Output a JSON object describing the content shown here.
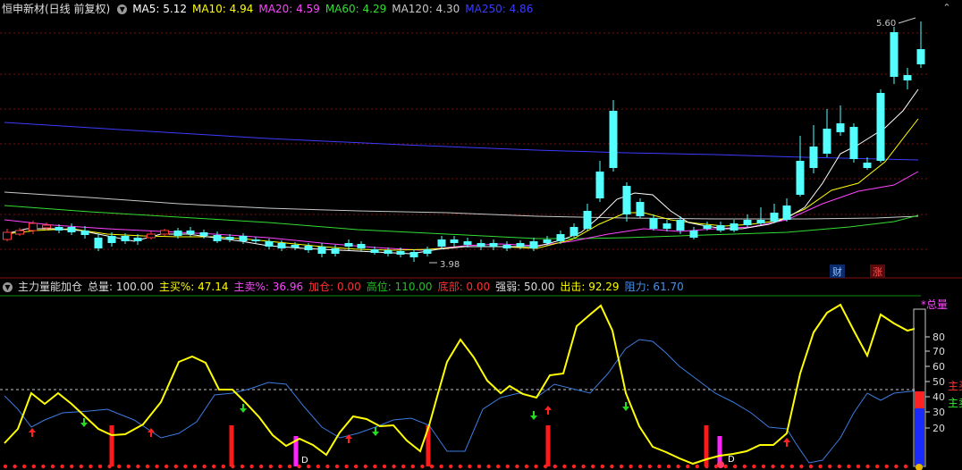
{
  "top_panel": {
    "title": "恒申新材(日线 前复权)",
    "ma": [
      {
        "label": "MA5: 5.12",
        "color": "#ffffff"
      },
      {
        "label": "MA10: 4.94",
        "color": "#ffff00"
      },
      {
        "label": "MA20: 4.59",
        "color": "#ff44ff"
      },
      {
        "label": "MA60: 4.29",
        "color": "#33dd33"
      },
      {
        "label": "MA120: 4.30",
        "color": "#c8c8c8"
      },
      {
        "label": "MA250: 4.86",
        "color": "#3b3bff"
      }
    ],
    "high_label": "5.60",
    "low_label": "3.98",
    "badge_cai": "财",
    "badge_zhang": "涨",
    "nav_up": "⌃",
    "nav_down": "⌄"
  },
  "bottom_panel": {
    "title": "主力量能加仓",
    "items": [
      {
        "label": "总量: 100.00",
        "color": "#dcdcdc"
      },
      {
        "label": "主买%: 47.14",
        "color": "#ffff00"
      },
      {
        "label": "主卖%: 36.96",
        "color": "#ff44ff"
      },
      {
        "label": "加仓: 0.00",
        "color": "#ff3030"
      },
      {
        "label": "高位: 110.00",
        "color": "#22c022"
      },
      {
        "label": "底部: 0.00",
        "color": "#ff3030"
      },
      {
        "label": "强弱: 50.00",
        "color": "#dcdcdc"
      },
      {
        "label": "出击: 92.29",
        "color": "#ffff00"
      },
      {
        "label": "阻力: 61.70",
        "color": "#4a90e2"
      }
    ],
    "scale_labels": [
      "80",
      "70",
      "60",
      "50",
      "40",
      "30",
      "20"
    ],
    "legend_total": "*总量",
    "legend_buy": "主买",
    "legend_sell": "主卖",
    "marker_d1": "D",
    "marker_d2": "D"
  },
  "colors": {
    "up": "#ff3b3b",
    "down": "#54ffff",
    "yellow": "#ffff00",
    "blue": "#3c7be0",
    "magenta": "#ff22ff"
  }
}
